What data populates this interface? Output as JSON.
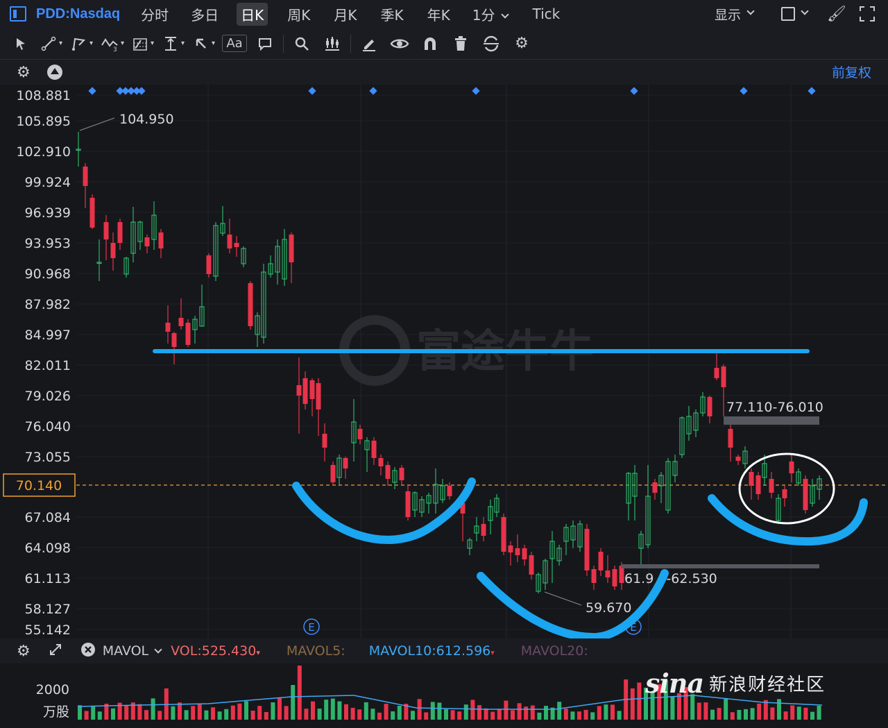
{
  "header": {
    "symbol": "PDD:Nasdaq",
    "tabs": [
      "分时",
      "多日",
      "日K",
      "周K",
      "月K",
      "季K",
      "年K"
    ],
    "active_tab": "日K",
    "interval": "1分",
    "tick": "Tick",
    "display": "显示"
  },
  "subbar": {
    "adjust": "前复权"
  },
  "price_axis": {
    "ticks": [
      "108.881",
      "105.895",
      "102.910",
      "99.924",
      "96.939",
      "93.953",
      "90.968",
      "87.982",
      "84.997",
      "82.011",
      "79.026",
      "76.040",
      "73.055",
      "67.084",
      "64.098",
      "61.113",
      "58.127",
      "55.142"
    ],
    "current": "70.140"
  },
  "annotations": {
    "high_label": "104.950",
    "low_label": "59.670",
    "resistance_zone": "77.110-76.010",
    "support_zone": "61.9 0-62.530",
    "earnings_marker": "E"
  },
  "watermark_center": "富途牛牛",
  "volume_panel": {
    "indicator": "MAVOL",
    "vol": "VOL:525.430",
    "mavol5": "MAVOL5:",
    "mavol10": "MAVOL10:612.596",
    "mavol20": "MAVOL20:",
    "axis_value": "2000",
    "unit": "万股"
  },
  "watermark": {
    "brand": "sina",
    "text": "新浪财经社区"
  },
  "colors": {
    "accent": "#3f8cff",
    "up": "#2fb36b",
    "down": "#e8334a",
    "annotation_blue": "#1aa6f0",
    "current_price": "#f0a030"
  }
}
